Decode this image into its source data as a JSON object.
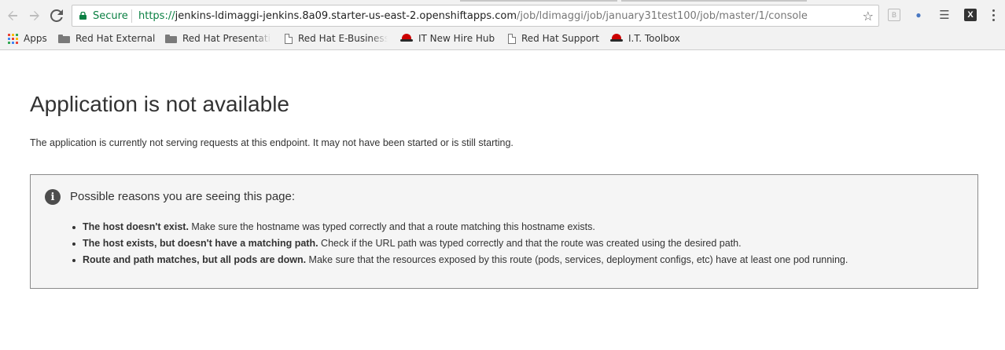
{
  "browser": {
    "secure_label": "Secure",
    "url_scheme": "https://",
    "url_host": "jenkins-ldimaggi-jenkins.8a09.starter-us-east-2.openshiftapps.com",
    "url_path": "/job/ldimaggi/job/january31test100/job/master/1/console",
    "icons": {
      "back": "back-arrow-icon",
      "forward": "forward-arrow-icon",
      "reload": "reload-icon",
      "lock": "lock-icon",
      "bookmark_star": "star-icon"
    },
    "colors": {
      "secure": "#0b8043",
      "chrome": "#f2f2f2"
    }
  },
  "bookmarks": [
    {
      "label": "Apps",
      "icon": "apps-grid-icon"
    },
    {
      "label": "Red Hat External",
      "icon": "folder-icon"
    },
    {
      "label": "Red Hat Presentati",
      "icon": "folder-icon"
    },
    {
      "label": "Red Hat E-Business",
      "icon": "page-icon"
    },
    {
      "label": "IT New Hire Hub",
      "icon": "redhat-icon"
    },
    {
      "label": "Red Hat Support",
      "icon": "page-icon"
    },
    {
      "label": "I.T. Toolbox",
      "icon": "redhat-icon"
    }
  ],
  "page": {
    "title": "Application is not available",
    "intro": "The application is currently not serving requests at this endpoint. It may not have been started or is still starting.",
    "reasons": {
      "icon": "info-icon",
      "heading": "Possible reasons you are seeing this page:",
      "items": [
        {
          "bold": "The host doesn't exist.",
          "text": " Make sure the hostname was typed correctly and that a route matching this hostname exists."
        },
        {
          "bold": "The host exists, but doesn't have a matching path.",
          "text": " Check if the URL path was typed correctly and that the route was created using the desired path."
        },
        {
          "bold": "Route and path matches, but all pods are down.",
          "text": " Make sure that the resources exposed by this route (pods, services, deployment configs, etc) have at least one pod running."
        }
      ]
    }
  }
}
